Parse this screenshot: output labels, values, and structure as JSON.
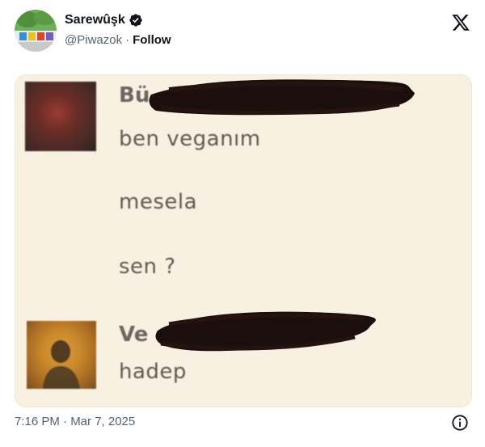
{
  "tweet": {
    "display_name": "Sarewûşk",
    "handle": "@Piwazok",
    "separator": "·",
    "follow_label": "Follow",
    "timestamp": "7:16 PM · Mar 7, 2025",
    "verified": true
  },
  "chat": {
    "message1": {
      "sender_visible": "Bü",
      "lines": [
        "ben veganım",
        "mesela",
        "sen ?"
      ]
    },
    "message2": {
      "sender_visible": "Ve",
      "lines": [
        "hadep"
      ]
    }
  },
  "icons": {
    "verified": "verified-badge-icon",
    "brand": "x-logo-icon",
    "info": "info-icon"
  },
  "colors": {
    "text_primary": "#0f1419",
    "text_secondary": "#536471",
    "media_background": "#f8f1e2",
    "redaction": "#1a0f0c"
  }
}
